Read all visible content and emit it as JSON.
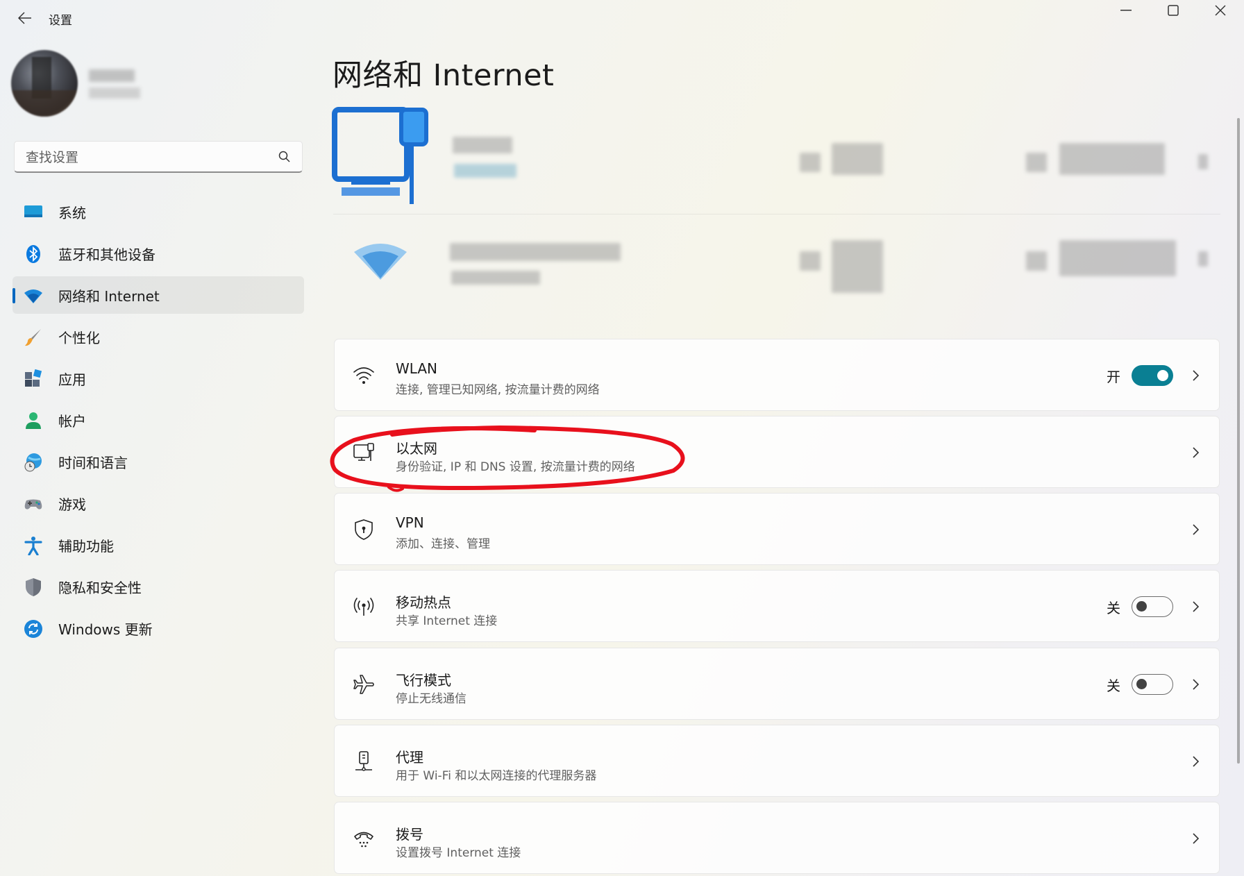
{
  "window": {
    "title": "设置"
  },
  "search": {
    "placeholder": "查找设置"
  },
  "sidebar": {
    "items": [
      {
        "label": "系统",
        "icon": "monitor-icon"
      },
      {
        "label": "蓝牙和其他设备",
        "icon": "bluetooth-icon"
      },
      {
        "label": "网络和 Internet",
        "icon": "wifi-icon",
        "selected": true
      },
      {
        "label": "个性化",
        "icon": "brush-icon"
      },
      {
        "label": "应用",
        "icon": "apps-icon"
      },
      {
        "label": "帐户",
        "icon": "person-icon"
      },
      {
        "label": "时间和语言",
        "icon": "globe-clock-icon"
      },
      {
        "label": "游戏",
        "icon": "gamepad-icon"
      },
      {
        "label": "辅助功能",
        "icon": "accessibility-icon"
      },
      {
        "label": "隐私和安全性",
        "icon": "shield-icon"
      },
      {
        "label": "Windows 更新",
        "icon": "update-icon"
      }
    ]
  },
  "page": {
    "title": "网络和 Internet"
  },
  "cards": [
    {
      "title": "WLAN",
      "subtitle": "连接, 管理已知网络, 按流量计费的网络",
      "icon": "wifi-icon",
      "state": "开",
      "toggle": "on"
    },
    {
      "title": "以太网",
      "subtitle": "身份验证, IP 和 DNS 设置, 按流量计费的网络",
      "icon": "ethernet-icon"
    },
    {
      "title": "VPN",
      "subtitle": "添加、连接、管理",
      "icon": "vpn-shield-icon"
    },
    {
      "title": "移动热点",
      "subtitle": "共享 Internet 连接",
      "icon": "hotspot-icon",
      "state": "关",
      "toggle": "off"
    },
    {
      "title": "飞行模式",
      "subtitle": "停止无线通信",
      "icon": "airplane-icon",
      "state": "关",
      "toggle": "off"
    },
    {
      "title": "代理",
      "subtitle": "用于 Wi-Fi 和以太网连接的代理服务器",
      "icon": "proxy-icon"
    },
    {
      "title": "拨号",
      "subtitle": "设置拨号 Internet 连接",
      "icon": "dialup-icon"
    }
  ],
  "colors": {
    "accent": "#0067c0",
    "toggle_on": "#0a7f93",
    "annotation": "#e8101c"
  }
}
